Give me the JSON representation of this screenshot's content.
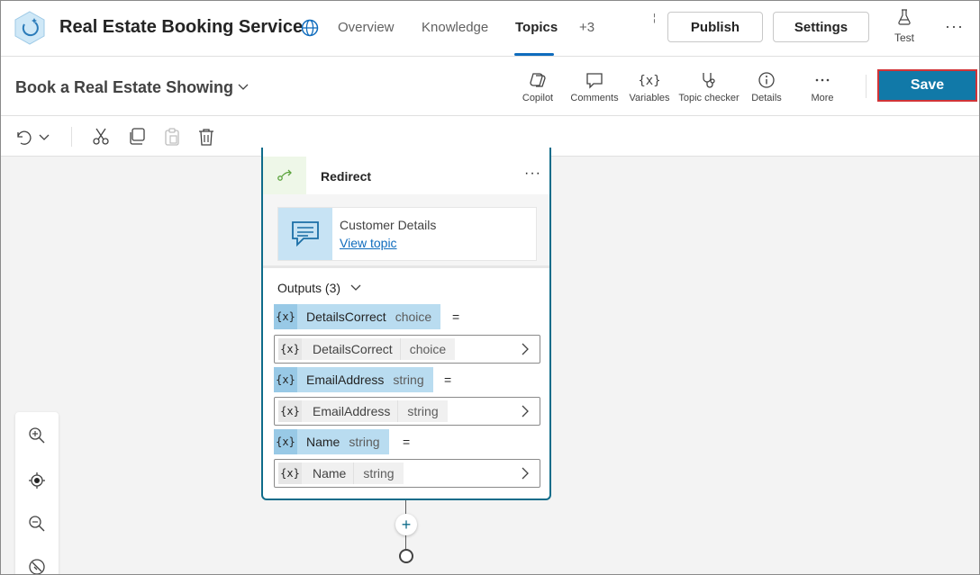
{
  "header": {
    "app_title": "Real Estate Booking Service",
    "nav_tabs": [
      {
        "label": "Overview",
        "active": false
      },
      {
        "label": "Knowledge",
        "active": false
      },
      {
        "label": "Topics",
        "active": true
      },
      {
        "label": "+3",
        "active": false
      }
    ],
    "tiny_mark": "¦",
    "publish_label": "Publish",
    "settings_label": "Settings",
    "test_label": "Test",
    "more_glyph": "···"
  },
  "topic_bar": {
    "topic_name": "Book a Real Estate Showing",
    "tools": [
      {
        "label": "Copilot",
        "icon": "copilot-icon"
      },
      {
        "label": "Comments",
        "icon": "comment-icon"
      },
      {
        "label": "Variables",
        "icon": "variables-icon"
      },
      {
        "label": "Topic checker",
        "icon": "stethoscope-icon"
      },
      {
        "label": "Details",
        "icon": "info-icon"
      },
      {
        "label": "More",
        "icon": "more-icon"
      }
    ],
    "more_glyph": "···",
    "save_label": "Save"
  },
  "edit_toolbar": {
    "icons": [
      "undo-icon",
      "chevron-down-icon",
      "cut-icon",
      "copy-icon",
      "paste-icon",
      "delete-icon"
    ]
  },
  "node": {
    "title": "Redirect",
    "more_glyph": "···",
    "topic_ref": {
      "name": "Customer Details",
      "link": "View topic"
    },
    "outputs_label": "Outputs (3)",
    "outputs": [
      {
        "name": "DetailsCorrect",
        "type": "choice",
        "var_name": "DetailsCorrect",
        "var_type": "choice"
      },
      {
        "name": "EmailAddress",
        "type": "string",
        "var_name": "EmailAddress",
        "var_type": "string"
      },
      {
        "name": "Name",
        "type": "string",
        "var_name": "Name",
        "var_type": "string"
      }
    ],
    "var_glyph": "{x}",
    "equals": "="
  },
  "canvas": {
    "add_glyph": "+",
    "zoom_controls": [
      "zoom-in-icon",
      "locate-icon",
      "zoom-out-icon",
      "minimap-icon"
    ]
  },
  "colors": {
    "accent": "#0f6cbd",
    "save_bg": "#1179a8",
    "save_border": "#d13438",
    "node_border": "#0f6c8a",
    "chip_bg": "#b9dcf0"
  }
}
